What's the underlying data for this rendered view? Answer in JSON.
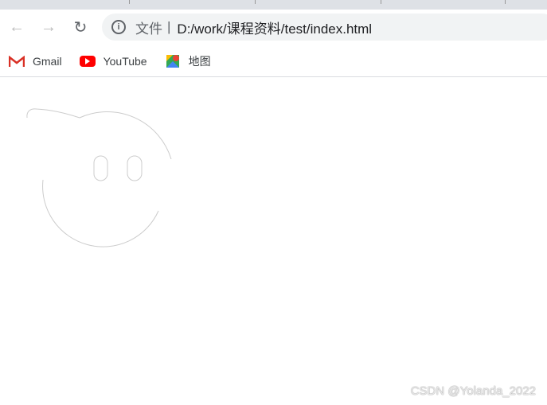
{
  "toolbar": {
    "back_icon": "arrow-left-icon",
    "forward_icon": "arrow-right-icon",
    "reload_icon": "reload-icon"
  },
  "omnibox": {
    "scheme_label": "文件",
    "separator": "|",
    "url": "D:/work/课程资料/test/index.html",
    "icon": "info-icon"
  },
  "bookmarks": [
    {
      "label": "Gmail",
      "icon": "gmail-icon"
    },
    {
      "label": "YouTube",
      "icon": "youtube-icon"
    },
    {
      "label": "地图",
      "icon": "maps-icon"
    }
  ],
  "watermark": "CSDN @Yolanda_2022",
  "colors": {
    "face_stroke": "#cccccc",
    "tabstrip": "#dee1e6",
    "omnibox": "#f1f3f4"
  }
}
